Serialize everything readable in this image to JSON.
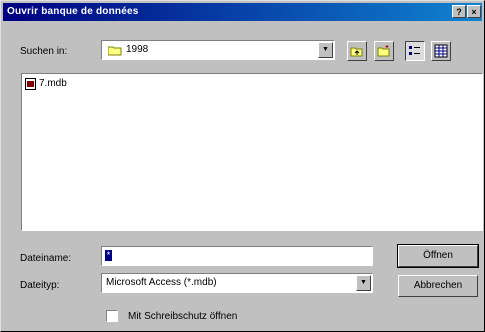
{
  "window": {
    "title": "Ouvrir banque de données",
    "help_glyph": "?",
    "close_glyph": "×"
  },
  "lookin": {
    "label": "Suchen in:",
    "value": "1998",
    "dropdown_icon": "triangle-down-icon"
  },
  "toolbar": {
    "buttons": [
      {
        "name": "up-one-level-icon"
      },
      {
        "name": "new-folder-icon"
      },
      {
        "name": "list-view-icon"
      },
      {
        "name": "details-view-icon"
      }
    ]
  },
  "files": [
    {
      "name": "7.mdb",
      "icon": "access-database-icon"
    }
  ],
  "filename": {
    "label": "Dateiname:",
    "value": "*"
  },
  "filetype": {
    "label": "Dateityp:",
    "value": "Microsoft Access (*.mdb)"
  },
  "buttons": {
    "open": "Öffnen",
    "cancel": "Abbrechen"
  },
  "readonly": {
    "label": "Mit Schreibschutz öffnen",
    "checked": false
  },
  "colors": {
    "title_bg_start": "#000080",
    "title_bg_end": "#1084d0",
    "face": "#c0c0c0"
  }
}
